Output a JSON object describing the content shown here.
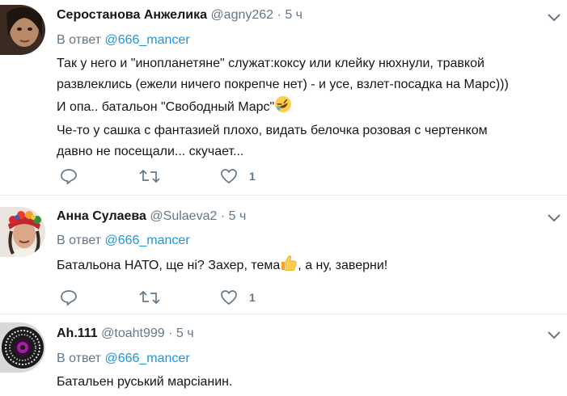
{
  "tweets": [
    {
      "name": "Серостанова Анжелика",
      "handle": "@agny262",
      "dot": "·",
      "time": "5 ч",
      "reply_prefix": "В ответ",
      "reply_to": "@666_mancer",
      "lines": [
        "Так у него и \"инопланетяне\" служат:коксу или клейку нюхнули,  травкой",
        "развлеклись (ежели ничего покрепче нет) - и усе, взлет-посадка на Марс)))",
        "И опа.. батальон \"Свободный Марс\"",
        "Че-то у сашка с фантазией плохо, видать белочка розовая с чертенком",
        "давно не посещали... скучает..."
      ],
      "emoji_after_line": 2,
      "emoji": "rolling-laughing-emoji",
      "likes": "1"
    },
    {
      "name": "Анна Сулаева",
      "handle": "@Sulaeva2",
      "dot": "·",
      "time": "5 ч",
      "reply_prefix": "В ответ",
      "reply_to": "@666_mancer",
      "text_before": "Батальона НАТО, ще ні? Захер, тема",
      "text_after": ", а ну, заверни!",
      "emoji": "thumbs-up-emoji",
      "likes": "1"
    },
    {
      "name": "Ah.111",
      "handle": "@toaht999",
      "dot": "·",
      "time": "5 ч",
      "reply_prefix": "В ответ",
      "reply_to": "@666_mancer",
      "text": "Батальен руський марсіанин."
    }
  ],
  "colors": {
    "link": "#1b95e0",
    "secondary": "#657786",
    "primary": "#14171a",
    "divider": "#e6ecf0"
  }
}
